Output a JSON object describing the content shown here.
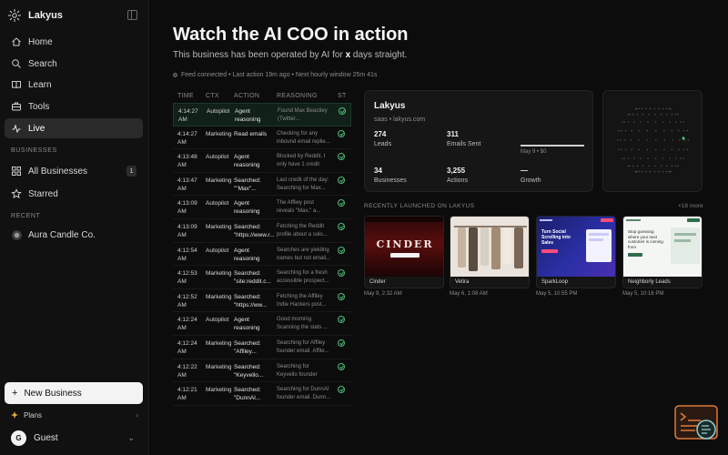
{
  "brand": {
    "name": "Lakyus"
  },
  "sidebar": {
    "nav": [
      {
        "label": "Home",
        "icon": "home-icon"
      },
      {
        "label": "Search",
        "icon": "search-icon"
      },
      {
        "label": "Learn",
        "icon": "book-icon"
      },
      {
        "label": "Tools",
        "icon": "tools-icon"
      },
      {
        "label": "Live",
        "icon": "live-icon",
        "active": true
      }
    ],
    "businesses_label": "BUSINESSES",
    "all_businesses": {
      "label": "All Businesses",
      "count": "1"
    },
    "starred": {
      "label": "Starred"
    },
    "recent_label": "RECENT",
    "recent": [
      {
        "label": "Aura Candle Co."
      }
    ],
    "new_business": "New Business",
    "plans": "Plans",
    "user": {
      "initial": "G",
      "name": "Guest"
    }
  },
  "header": {
    "title": "Watch the AI COO in action",
    "subtitle_pre": "This business has been operated by AI for ",
    "subtitle_x": "x",
    "subtitle_post": " days straight.",
    "status": "Feed connected • Last action 19m ago • Next hourly window 25m 41s"
  },
  "activity": {
    "columns": [
      "TIME",
      "CTX",
      "ACTION",
      "REASONING",
      "ST"
    ],
    "rows": [
      {
        "time": "4:14:27 AM",
        "ctx": "Autopilot",
        "action": "Agent reasoning",
        "reason": "Found Max Beastley (Twitter...",
        "highlight": true
      },
      {
        "time": "4:14:27 AM",
        "ctx": "Marketing",
        "action": "Read emails",
        "reason": "Checking for any inbound email replie..."
      },
      {
        "time": "4:13:48 AM",
        "ctx": "Autopilot",
        "action": "Agent reasoning",
        "reason": "Blocked by Reddit. I only have 1 credit lef..."
      },
      {
        "time": "4:13:47 AM",
        "ctx": "Marketing",
        "action": "Searched: \"\"Max\"...",
        "reason": "Last credit of the day: Searching for Max..."
      },
      {
        "time": "4:13:09 AM",
        "ctx": "Autopilot",
        "action": "Agent reasoning",
        "reason": "The Affiley post reveals \"Max,\" a..."
      },
      {
        "time": "4:13:09 AM",
        "ctx": "Marketing",
        "action": "Searched: \"https://www.r...",
        "reason": "Fetching the Reddit profile about a solo..."
      },
      {
        "time": "4:12:54 AM",
        "ctx": "Autopilot",
        "action": "Agent reasoning",
        "reason": "Searches are yielding names but not email..."
      },
      {
        "time": "4:12:53 AM",
        "ctx": "Marketing",
        "action": "Searched: \"site:reddit.c...",
        "reason": "Searching for a fresh accessible prospect..."
      },
      {
        "time": "4:12:52 AM",
        "ctx": "Marketing",
        "action": "Searched: \"https://ww...",
        "reason": "Fetching the Affiley Indie Hackers post..."
      },
      {
        "time": "4:12:24 AM",
        "ctx": "Autopilot",
        "action": "Agent reasoning",
        "reason": "Good morning. Scanning the stats ..."
      },
      {
        "time": "4:12:24 AM",
        "ctx": "Marketing",
        "action": "Searched: \"Affiley...",
        "reason": "Searching for Affiley founder email. Affile..."
      },
      {
        "time": "4:12:22 AM",
        "ctx": "Marketing",
        "action": "Searched: \"Keyvello...",
        "reason": "Searching for Keyvello founder email..."
      },
      {
        "time": "4:12:21 AM",
        "ctx": "Marketing",
        "action": "Searched: \"DunnAI...",
        "reason": "Searching for DunnAI founder email. Dunn..."
      }
    ]
  },
  "business": {
    "name": "Lakyus",
    "sub": "saas • lakyus.com",
    "stats": [
      {
        "value": "274",
        "label": "Leads"
      },
      {
        "value": "311",
        "label": "Emails Sent"
      },
      {
        "value": "34",
        "label": "Businesses"
      },
      {
        "value": "3,255",
        "label": "Actions"
      },
      {
        "value": "—",
        "label": "Growth"
      }
    ],
    "spark_label": "May 9 • $0"
  },
  "recently": {
    "label": "RECENTLY LAUNCHED ON LAKYUS",
    "more": "+18 more",
    "sites": [
      {
        "name": "Cinder",
        "date": "May 9, 2:32 AM",
        "thumb_text": "CINDER"
      },
      {
        "name": "Vetira",
        "date": "May 6, 1:08 AM"
      },
      {
        "name": "SparkLoop",
        "date": "May 5, 10:55 PM",
        "thumb_text": "Turn Social Scrolling into Sales"
      },
      {
        "name": "Neighborly Leads",
        "date": "May 5, 10:16 PM",
        "thumb_text": "Stop guessing where your next customer is coming from"
      }
    ]
  },
  "colors": {
    "accent_green": "#4dbb7a",
    "background": "#0c0c0c"
  }
}
